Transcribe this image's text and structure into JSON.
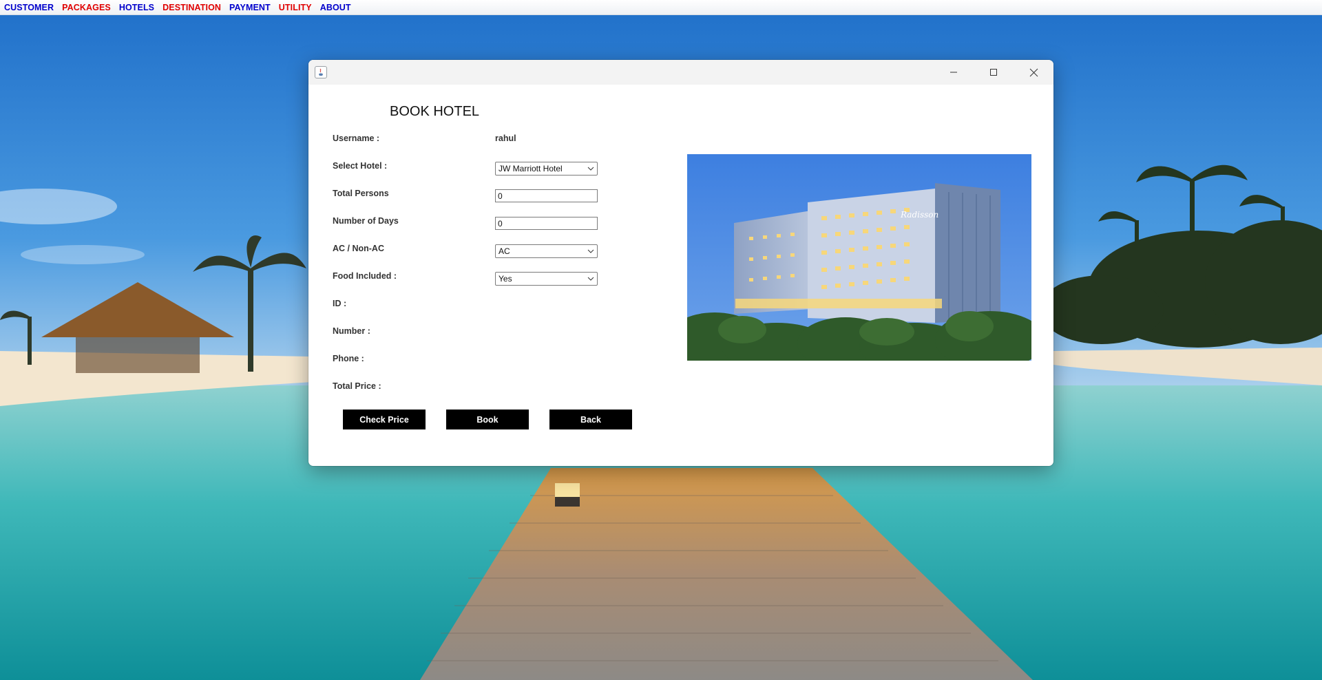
{
  "menubar": {
    "items": [
      {
        "label": "CUSTOMER",
        "color": "#0000cc"
      },
      {
        "label": "PACKAGES",
        "color": "#e00000"
      },
      {
        "label": "HOTELS",
        "color": "#0000cc"
      },
      {
        "label": "DESTINATION",
        "color": "#e00000"
      },
      {
        "label": "PAYMENT",
        "color": "#0000cc"
      },
      {
        "label": "UTILITY",
        "color": "#e00000"
      },
      {
        "label": "ABOUT",
        "color": "#0000cc"
      }
    ]
  },
  "window": {
    "heading": "BOOK HOTEL",
    "fields": {
      "username": {
        "label": "Username :",
        "value": "rahul"
      },
      "select_hotel": {
        "label": "Select Hotel :",
        "value": "JW Marriott Hotel"
      },
      "total_persons": {
        "label": "Total Persons",
        "value": "0"
      },
      "number_of_days": {
        "label": "Number of Days",
        "value": "0"
      },
      "ac_non_ac": {
        "label": "AC / Non-AC",
        "value": "AC"
      },
      "food_included": {
        "label": "Food Included :",
        "value": "Yes"
      },
      "id": {
        "label": "ID :"
      },
      "number": {
        "label": "Number :"
      },
      "phone": {
        "label": "Phone :"
      },
      "total_price": {
        "label": "Total Price :"
      }
    },
    "buttons": {
      "check_price": "Check Price",
      "book": "Book",
      "back": "Back"
    },
    "photo_sign": "Radisson"
  },
  "colors": {
    "menu_blue": "#0000cc",
    "menu_red": "#e00000",
    "button_bg": "#000000",
    "button_text": "#ffffff"
  }
}
